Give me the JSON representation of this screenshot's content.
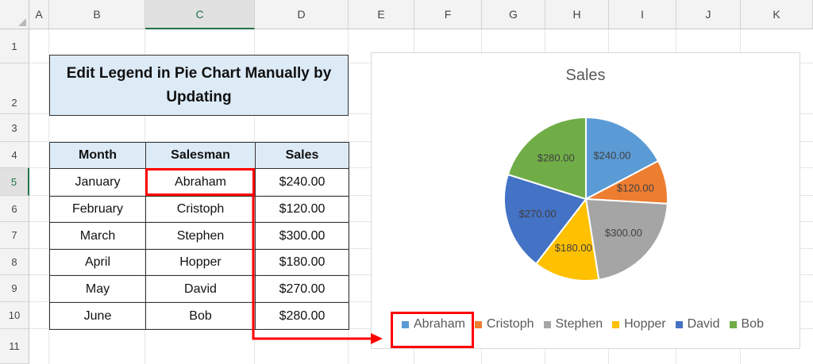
{
  "sheet": {
    "columns": [
      "A",
      "B",
      "C",
      "D",
      "E",
      "F",
      "G",
      "H",
      "I",
      "J",
      "K"
    ],
    "rows": [
      "1",
      "2",
      "3",
      "4",
      "5",
      "6",
      "7",
      "8",
      "9",
      "10",
      "11"
    ],
    "selected_column": "C",
    "selected_row": "5"
  },
  "title_cell": {
    "text": "Edit Legend in Pie Chart Manually by Updating"
  },
  "table": {
    "headers": [
      "Month",
      "Salesman",
      "Sales"
    ],
    "rows": [
      [
        "January",
        "Abraham",
        "$240.00"
      ],
      [
        "February",
        "Cristoph",
        "$120.00"
      ],
      [
        "March",
        "Stephen",
        "$300.00"
      ],
      [
        "April",
        "Hopper",
        "$180.00"
      ],
      [
        "May",
        "David",
        "$270.00"
      ],
      [
        "June",
        "Bob",
        "$280.00"
      ]
    ]
  },
  "chart_data": {
    "type": "pie",
    "title": "Sales",
    "categories": [
      "Abraham",
      "Cristoph",
      "Stephen",
      "Hopper",
      "David",
      "Bob"
    ],
    "values": [
      240,
      120,
      300,
      180,
      270,
      280
    ],
    "data_labels": [
      "$240.00",
      "$120.00",
      "$300.00",
      "$180.00",
      "$270.00",
      "$280.00"
    ],
    "colors": [
      "#5b9bd5",
      "#ed7d31",
      "#a5a5a5",
      "#ffc000",
      "#4472c4",
      "#70ad47"
    ],
    "legend_position": "bottom"
  },
  "highlight_color": "#ff0000"
}
